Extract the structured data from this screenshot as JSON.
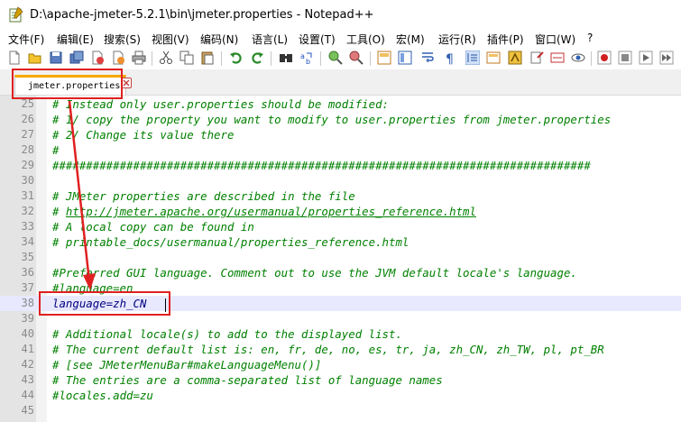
{
  "window": {
    "title": "D:\\apache-jmeter-5.2.1\\bin\\jmeter.properties - Notepad++"
  },
  "menu": [
    "文件(F)",
    "编辑(E)",
    "搜索(S)",
    "视图(V)",
    "编码(N)",
    "语言(L)",
    "设置(T)",
    "工具(O)",
    "宏(M)",
    "运行(R)",
    "插件(P)",
    "窗口(W)",
    "?"
  ],
  "toolbar": {
    "icons": [
      "new-file-icon",
      "open-file-icon",
      "save-icon",
      "save-all-icon",
      "close-icon",
      "close-all-icon",
      "print-icon",
      "cut-icon",
      "copy-icon",
      "paste-icon",
      "undo-icon",
      "redo-icon",
      "find-icon",
      "replace-icon",
      "zoom-in-icon",
      "zoom-out-icon",
      "sync-vertical-icon",
      "sync-horizontal-icon",
      "word-wrap-icon",
      "show-all-chars-icon",
      "indent-guide-icon",
      "document-map-icon",
      "function-list-icon",
      "folder-workspace-icon",
      "monitoring-icon",
      "record-macro-icon",
      "stop-record-icon",
      "play-macro-icon",
      "run-macro-multiple-icon"
    ]
  },
  "tab": {
    "label": "jmeter.properties"
  },
  "editor": {
    "lines": [
      {
        "n": "25",
        "text": "# Instead only user.properties should be modified:",
        "kind": "comment"
      },
      {
        "n": "26",
        "text": "# 1/ copy the property you want to modify to user.properties from jmeter.properties",
        "kind": "comment"
      },
      {
        "n": "27",
        "text": "# 2/ Change its value there",
        "kind": "comment"
      },
      {
        "n": "28",
        "text": "#",
        "kind": "comment"
      },
      {
        "n": "29",
        "text": "################################################################################",
        "kind": "comment"
      },
      {
        "n": "30",
        "text": "",
        "kind": "comment"
      },
      {
        "n": "31",
        "text": "# JMeter properties are described in the file",
        "kind": "comment"
      },
      {
        "n": "32",
        "text_prefix": "# ",
        "url": "http://jmeter.apache.org/usermanual/properties_reference.html",
        "kind": "url"
      },
      {
        "n": "33",
        "text": "# A local copy can be found in",
        "kind": "comment"
      },
      {
        "n": "34",
        "text": "# printable_docs/usermanual/properties_reference.html",
        "kind": "comment"
      },
      {
        "n": "35",
        "text": "",
        "kind": "comment"
      },
      {
        "n": "36",
        "text": "#Preferred GUI language. Comment out to use the JVM default locale's language.",
        "kind": "comment"
      },
      {
        "n": "37",
        "text": "#language=en",
        "kind": "comment"
      },
      {
        "n": "38",
        "text": "language=zh_CN",
        "kind": "plain"
      },
      {
        "n": "39",
        "text": "",
        "kind": "comment"
      },
      {
        "n": "40",
        "text": "# Additional locale(s) to add to the displayed list.",
        "kind": "comment"
      },
      {
        "n": "41",
        "text": "# The current default list is: en, fr, de, no, es, tr, ja, zh_CN, zh_TW, pl, pt_BR",
        "kind": "comment"
      },
      {
        "n": "42",
        "text": "# [see JMeterMenuBar#makeLanguageMenu()]",
        "kind": "comment"
      },
      {
        "n": "43",
        "text": "# The entries are a comma-separated list of language names",
        "kind": "comment"
      },
      {
        "n": "44",
        "text": "#locales.add=zu",
        "kind": "comment"
      },
      {
        "n": "45",
        "text": "",
        "kind": "comment"
      }
    ],
    "current_line": "38"
  },
  "colors": {
    "comment": "#008000",
    "plain": "#000080",
    "annotation": "#e02020",
    "current_line_bg": "#e8e8ff"
  }
}
